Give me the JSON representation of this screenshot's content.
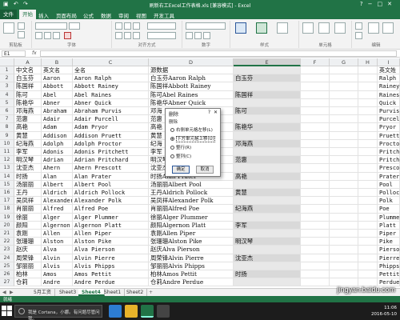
{
  "window": {
    "title": "刷新右工Excel工作表格.xls [兼容模式] - Excel",
    "controls": [
      "?",
      "−",
      "□",
      "✕"
    ]
  },
  "ribbon": {
    "tabs": [
      "文件",
      "开始",
      "插入",
      "页面布局",
      "公式",
      "数据",
      "审阅",
      "视图",
      "开发工具"
    ],
    "active_tab": "开始",
    "groups": [
      "剪贴板",
      "字体",
      "对齐方式",
      "数字",
      "样式",
      "单元格",
      "编辑"
    ]
  },
  "formula_bar": {
    "name_box": "E1",
    "fx": "fx",
    "content": ""
  },
  "grid": {
    "columns": [
      "A",
      "B",
      "C",
      "D",
      "E",
      "F",
      "G",
      "H",
      "I"
    ],
    "selected_column": "E",
    "rows": [
      {
        "n": "1",
        "A": "中文名",
        "B": "英文名",
        "C": "全名",
        "D": "源数据",
        "E": "",
        "F": "",
        "G": "",
        "H": "",
        "I": "英文姓"
      },
      {
        "n": "2",
        "A": "白玉芬",
        "B": "Aaron",
        "C": "Aaron Ralph",
        "D": "白玉芬Aaron Ralph",
        "E": "白玉芬",
        "F": "",
        "G": "",
        "H": "",
        "I": "Ralph"
      },
      {
        "n": "3",
        "A": "陈国祥",
        "B": "Abbott",
        "C": "Abbott Rainey",
        "D": "陈国祥Abbott Rainey",
        "E": "",
        "F": "",
        "G": "",
        "H": "",
        "I": "Rainey"
      },
      {
        "n": "4",
        "A": "陈可",
        "B": "Abel",
        "C": "Abel Raines",
        "D": "陈可Abel Raines",
        "E": "陈国祥",
        "F": "",
        "G": "",
        "H": "",
        "I": "Raines"
      },
      {
        "n": "5",
        "A": "陈艳华",
        "B": "Abner",
        "C": "Abner Quick",
        "D": "陈艳华Abner Quick",
        "E": "",
        "F": "",
        "G": "",
        "H": "",
        "I": "Quick"
      },
      {
        "n": "6",
        "A": "邓海燕",
        "B": "Abraham",
        "C": "Abraham Purvis",
        "D": "邓海",
        "E": "陈可",
        "F": "",
        "G": "",
        "H": "",
        "I": "Purvis"
      },
      {
        "n": "7",
        "A": "范惠",
        "B": "Adair",
        "C": "Adair Purcell",
        "D": "范惠",
        "E": "",
        "F": "",
        "G": "",
        "H": "",
        "I": "Purcell"
      },
      {
        "n": "8",
        "A": "高艳",
        "B": "Adam",
        "C": "Adam Pryor",
        "D": "高艳",
        "E": "陈艳华",
        "F": "",
        "G": "",
        "H": "",
        "I": "Pryor"
      },
      {
        "n": "9",
        "A": "黄慧",
        "B": "Addison",
        "C": "Addison Pruett",
        "D": "黄慧",
        "E": "",
        "F": "",
        "G": "",
        "H": "",
        "I": "Pruett"
      },
      {
        "n": "10",
        "A": "纪海燕",
        "B": "Adolph",
        "C": "Adolph Proctor",
        "D": "纪海",
        "E": "邓海燕",
        "F": "",
        "G": "",
        "H": "",
        "I": "Proctor"
      },
      {
        "n": "11",
        "A": "李军",
        "B": "Adonis",
        "C": "Adonis Pritchett",
        "D": "李军",
        "E": "",
        "F": "",
        "G": "",
        "H": "",
        "I": "Pritchett"
      },
      {
        "n": "12",
        "A": "明汉琴",
        "B": "Adrian",
        "C": "Adrian Pritchard",
        "D": "明汉琴Adrian Pritchard",
        "E": "范惠",
        "F": "",
        "G": "",
        "H": "",
        "I": "Pritchard"
      },
      {
        "n": "13",
        "A": "沈亚杰",
        "B": "Ahern",
        "C": "Ahern Prescott",
        "D": "沈亚杰Ahern Prescott",
        "E": "",
        "F": "",
        "G": "",
        "H": "",
        "I": "Prescott"
      },
      {
        "n": "14",
        "A": "时扬",
        "B": "Alan",
        "C": "Alan Prater",
        "D": "时扬Alan Prater",
        "E": "高艳",
        "F": "",
        "G": "",
        "H": "",
        "I": "Prater"
      },
      {
        "n": "15",
        "A": "汤丽丽",
        "B": "Albert",
        "C": "Albert Pool",
        "D": "汤丽丽Albert Pool",
        "E": "",
        "F": "",
        "G": "",
        "H": "",
        "I": "Pool"
      },
      {
        "n": "16",
        "A": "王丹",
        "B": "Aldrich",
        "C": "Aldrich Pollock",
        "D": "王丹Aldrich Pollock",
        "E": "黄慧",
        "F": "",
        "G": "",
        "H": "",
        "I": "Pollock"
      },
      {
        "n": "17",
        "A": "吴凤祥",
        "B": "Alexander",
        "C": "Alexander Polk",
        "D": "吴凤祥Alexander Polk",
        "E": "",
        "F": "",
        "G": "",
        "H": "",
        "I": "Polk"
      },
      {
        "n": "18",
        "A": "肖丽丽",
        "B": "Alfred",
        "C": "Alfred Poe",
        "D": "肖丽丽Alfred Poe",
        "E": "纪海燕",
        "F": "",
        "G": "",
        "H": "",
        "I": "Poe"
      },
      {
        "n": "19",
        "A": "徐丽",
        "B": "Alger",
        "C": "Alger Plummer",
        "D": "徐丽Alger Plummer",
        "E": "",
        "F": "",
        "G": "",
        "H": "",
        "I": "Plummer"
      },
      {
        "n": "20",
        "A": "颜阳",
        "B": "Algernon",
        "C": "Algernon Platt",
        "D": "颜阳Algernon Platt",
        "E": "李军",
        "F": "",
        "G": "",
        "H": "",
        "I": "Platt"
      },
      {
        "n": "21",
        "A": "袁刚",
        "B": "Allen",
        "C": "Allen Piper",
        "D": "袁刚Allen Piper",
        "E": "",
        "F": "",
        "G": "",
        "H": "",
        "I": "Piper"
      },
      {
        "n": "22",
        "A": "张珊珊",
        "B": "Alston",
        "C": "Alston Pike",
        "D": "张珊珊Alston Pike",
        "E": "明汉琴",
        "F": "",
        "G": "",
        "H": "",
        "I": "Pike"
      },
      {
        "n": "23",
        "A": "赵庆",
        "B": "Alva",
        "C": "Alva Pierson",
        "D": "赵庆Alva Pierson",
        "E": "",
        "F": "",
        "G": "",
        "H": "",
        "I": "Pierson"
      },
      {
        "n": "24",
        "A": "周荣锋",
        "B": "Alvin",
        "C": "Alvin Pierre",
        "D": "周荣锋Alvin Pierre",
        "E": "沈亚杰",
        "F": "",
        "G": "",
        "H": "",
        "I": "Pierre"
      },
      {
        "n": "25",
        "A": "邹丽丽",
        "B": "Alvis",
        "C": "Alvis Phipps",
        "D": "邹丽丽Alvis Phipps",
        "E": "",
        "F": "",
        "G": "",
        "H": "",
        "I": "Phipps"
      },
      {
        "n": "26",
        "A": "柏林",
        "B": "Amos",
        "C": "Amos Pettit",
        "D": "柏林Amos Pettit",
        "E": "时扬",
        "F": "",
        "G": "",
        "H": "",
        "I": "Pettit"
      },
      {
        "n": "27",
        "A": "仓莉",
        "B": "Andre",
        "C": "Andre Perdue",
        "D": "仓莉Andre Perdue",
        "E": "",
        "F": "",
        "G": "",
        "H": "",
        "I": "Perdue"
      }
    ]
  },
  "dialog": {
    "title": "删除",
    "help": "?",
    "close": "✕",
    "section": "删除",
    "options": [
      "右侧单元格左移(L)",
      "下方单元格上移(U)",
      "整行(R)",
      "整列(C)"
    ],
    "selected_index": 1,
    "ok": "确定",
    "cancel": "取消"
  },
  "sheets": {
    "tabs": [
      "5月工资",
      "Sheet3",
      "Sheet4",
      "Sheet1",
      "Sheet2"
    ],
    "active": "Sheet4",
    "add": "+"
  },
  "status": {
    "text": "就绪"
  },
  "taskbar": {
    "search_text": "我是 Cortana，小娜。有问题尽管问我。",
    "time": "11:06",
    "date": "2016-05-10"
  },
  "watermark": "jingyan.baidu.com",
  "colors": {
    "excel_green": "#217346",
    "gray_fill": "#d9d9d9",
    "taskbar": "#1c1c1c"
  }
}
